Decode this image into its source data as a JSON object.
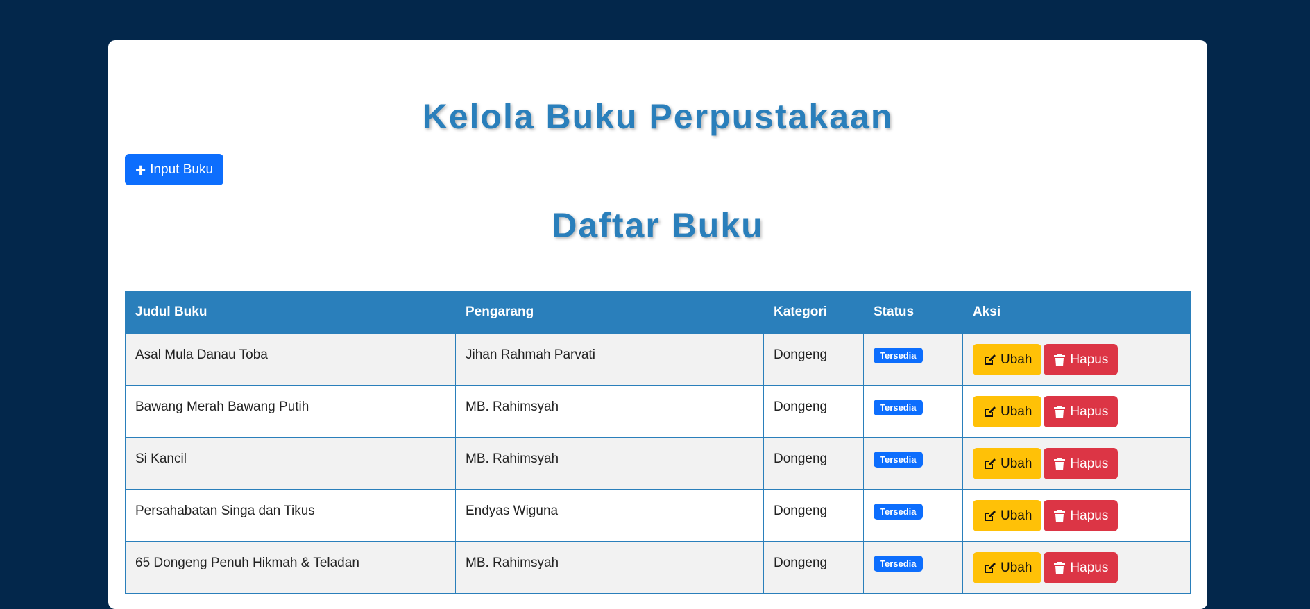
{
  "header": {
    "title": "Kelola Buku Perpustakaan",
    "input_button_label": "Input Buku"
  },
  "list": {
    "title": "Daftar Buku",
    "columns": [
      "Judul Buku",
      "Pengarang",
      "Kategori",
      "Status",
      "Aksi"
    ],
    "rows": [
      {
        "judul": "Asal Mula Danau Toba",
        "pengarang": "Jihan Rahmah Parvati",
        "kategori": "Dongeng",
        "status": "Tersedia"
      },
      {
        "judul": "Bawang Merah Bawang Putih",
        "pengarang": "MB. Rahimsyah",
        "kategori": "Dongeng",
        "status": "Tersedia"
      },
      {
        "judul": "Si Kancil",
        "pengarang": "MB. Rahimsyah",
        "kategori": "Dongeng",
        "status": "Tersedia"
      },
      {
        "judul": "Persahabatan Singa dan Tikus",
        "pengarang": "Endyas Wiguna",
        "kategori": "Dongeng",
        "status": "Tersedia"
      },
      {
        "judul": "65 Dongeng Penuh Hikmah & Teladan",
        "pengarang": "MB. Rahimsyah",
        "kategori": "Dongeng",
        "status": "Tersedia"
      }
    ],
    "edit_label": "Ubah",
    "delete_label": "Hapus"
  },
  "colors": {
    "background": "#03274b",
    "accent": "#2a7fbb",
    "primary": "#0d6efd",
    "warning": "#ffc107",
    "danger": "#dc3545"
  },
  "icons": {
    "input": "plus-icon",
    "edit": "edit-icon",
    "delete": "trash-icon"
  }
}
